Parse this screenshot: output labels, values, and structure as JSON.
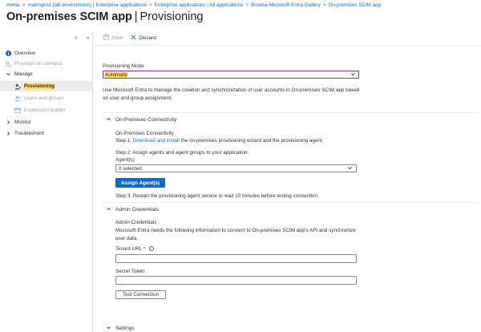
{
  "breadcrumb": [
    "Home",
    "matrixpost (lab environment) | Enterprise applications",
    "Enterprise applications | All applications",
    "Browse Microsoft Entra Gallery",
    "On-premises SCIM app"
  ],
  "breadcrumb_separator": ">",
  "header": {
    "title": "On-premises SCIM app",
    "separator": "|",
    "subtitle": "Provisioning"
  },
  "sidebar": {
    "collapse_icons": [
      "«",
      "»"
    ],
    "items": [
      {
        "label": "Overview",
        "icon": "info-icon"
      },
      {
        "label": "Provision on demand",
        "icon": "provision-on-demand-icon"
      },
      {
        "label": "Manage",
        "icon": "chevron-down-icon"
      },
      {
        "label": "Provisioning",
        "icon": "provisioning-icon",
        "selected": true
      },
      {
        "label": "Users and groups",
        "icon": "users-icon"
      },
      {
        "label": "Expression builder",
        "icon": "expression-builder-icon"
      },
      {
        "label": "Monitor",
        "icon": "chevron-right-icon"
      },
      {
        "label": "Troubleshoot",
        "icon": "chevron-right-icon"
      }
    ]
  },
  "toolbar": {
    "save_label": "Save",
    "discard_label": "Discard"
  },
  "provisioning_mode": {
    "label": "Provisioning Mode",
    "value": "Automatic",
    "description": "Use Microsoft Entra to manage the creation and synchronization of user accounts in On-premises SCIM app based on user and group assignment."
  },
  "onprem": {
    "section_title": "On-Premises Connectivity",
    "subtitle": "On-Premises Connectivity",
    "step1_prefix": "Step 1:",
    "step1_link": "Download and install",
    "step1_suffix": "the on-premises provisioning wizard and the provisioning agent.",
    "step2": "Step 2: Assign agents and agent groups to your application.",
    "agents_label": "Agent(s)",
    "agents_value": "0 selected",
    "assign_button": "Assign Agent(s)",
    "step3": "Step 3: Restart the provisioning agent service or wait 10 minutes before testing connection."
  },
  "admin": {
    "section_title": "Admin Credentials",
    "subtitle": "Admin Credentials",
    "description": "Microsoft Entra needs the following information to connect to On-premises SCIM app's API and synchronize user data.",
    "tenant_url_label": "Tenant URL",
    "required_mark": "*",
    "info_glyph": "i",
    "secret_token_label": "Secret Token",
    "test_button": "Test Connection"
  },
  "settings": {
    "section_title": "Settings"
  },
  "colors": {
    "accent": "#0f6cbd",
    "highlight": "#ffd966",
    "focus_border": "#8a2be2"
  }
}
